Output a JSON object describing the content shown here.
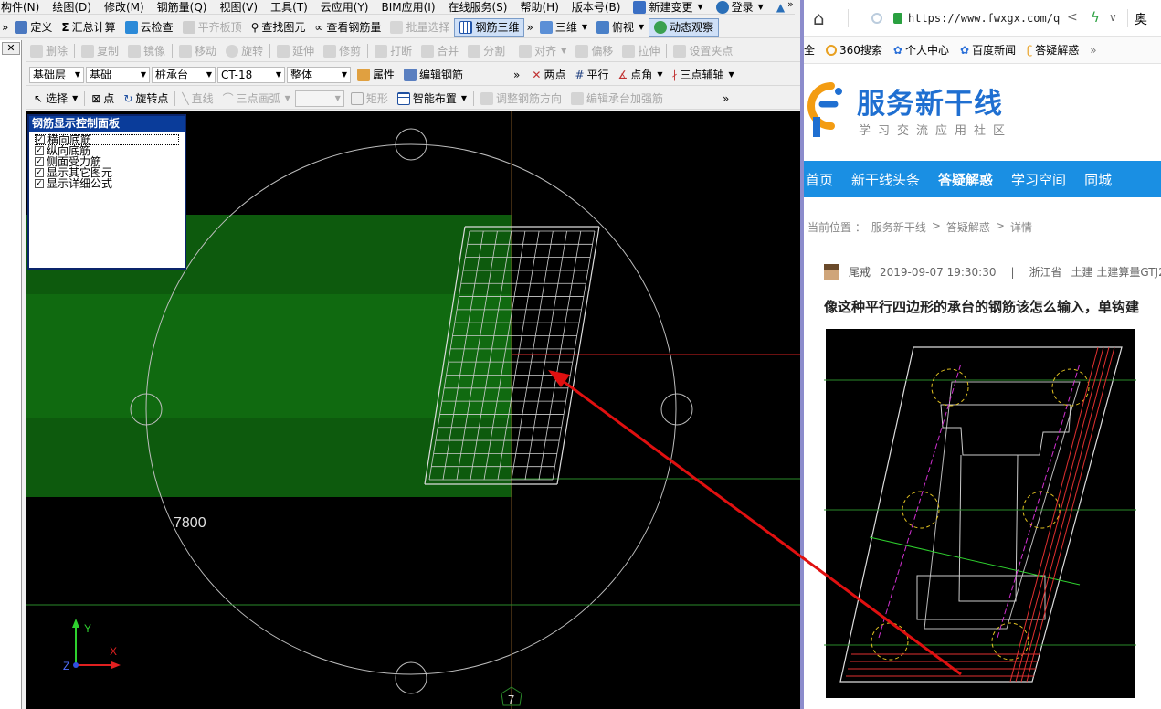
{
  "menubar": [
    "构件(N)",
    "绘图(D)",
    "修改(M)",
    "钢筋量(Q)",
    "视图(V)",
    "工具(T)",
    "云应用(Y)",
    "BIM应用(I)",
    "在线服务(S)",
    "帮助(H)",
    "版本号(B)",
    "新建变更",
    "登录"
  ],
  "toolbar1": {
    "define": "定义",
    "summary": "汇总计算",
    "cloud_check": "云检查",
    "flat_board": "平齐板顶",
    "find_element": "查找图元",
    "view_rebar": "查看钢筋量",
    "batch_select": "批量选择",
    "rebar_3d": "钢筋三维",
    "three_d": "三维",
    "top_view": "俯视",
    "dynamic_view": "动态观察"
  },
  "toolbar2": [
    "删除",
    "复制",
    "镜像",
    "移动",
    "旋转",
    "延伸",
    "修剪",
    "打断",
    "合并",
    "分割",
    "对齐",
    "偏移",
    "拉伸",
    "设置夹点"
  ],
  "toolbar3": {
    "layer": "基础层",
    "category": "基础",
    "type": "桩承台",
    "name": "CT-18",
    "scope": "整体",
    "properties": "属性",
    "edit_rebar": "编辑钢筋",
    "two_points": "两点",
    "parallel": "平行",
    "point_angle": "点角",
    "three_point_aux": "三点辅轴"
  },
  "toolbar4": {
    "select": "选择",
    "point": "点",
    "rotate_point": "旋转点",
    "line": "直线",
    "three_point_arc": "三点画弧",
    "rectangle": "矩形",
    "smart_layout": "智能布置",
    "adjust_direction": "调整钢筋方向",
    "edit_cap_rebar": "编辑承台加强筋"
  },
  "panel": {
    "title": "钢筋显示控制面板",
    "options": [
      "横向底筋",
      "纵向底筋",
      "侧面受力筋",
      "显示其它图元",
      "显示详细公式"
    ]
  },
  "canvas": {
    "dimension": "7800",
    "axis_number": "7",
    "axis_y": "Y",
    "axis_x": "X",
    "axis_z": "Z"
  },
  "browser": {
    "url": "https://www.fwxgx.com/q",
    "right_cut": "奥",
    "bookmarks": [
      "全",
      "360搜索",
      "个人中心",
      "百度新闻",
      "答疑解惑"
    ],
    "logo_title": "服务新干线",
    "logo_subtitle": "学习交流应用社区",
    "nav": [
      "首页",
      "新干线头条",
      "答疑解惑",
      "学习空间",
      "同城"
    ],
    "breadcrumb_label": "当前位置 ：",
    "breadcrumb": [
      "服务新干线",
      "答疑解惑",
      "详情"
    ],
    "breadcrumb_sep": ">",
    "author": "尾戒",
    "date": "2019-09-07 19:30:30",
    "meta_sep": "|",
    "location": "浙江省",
    "tags": "土建 土建算量GTJ2",
    "question_title": "像这种平行四边形的承台的钢筋该怎么输入，单钩建"
  },
  "colors": {
    "canvas_bg": "#000000",
    "highlight_green": "#0d5a0d",
    "panel_title_bg": "#0a3c9a",
    "nav_bg": "#1a8fe3",
    "arrow": "#e01010",
    "logo_orange": "#f39c12",
    "logo_blue": "#1f6fd1"
  }
}
